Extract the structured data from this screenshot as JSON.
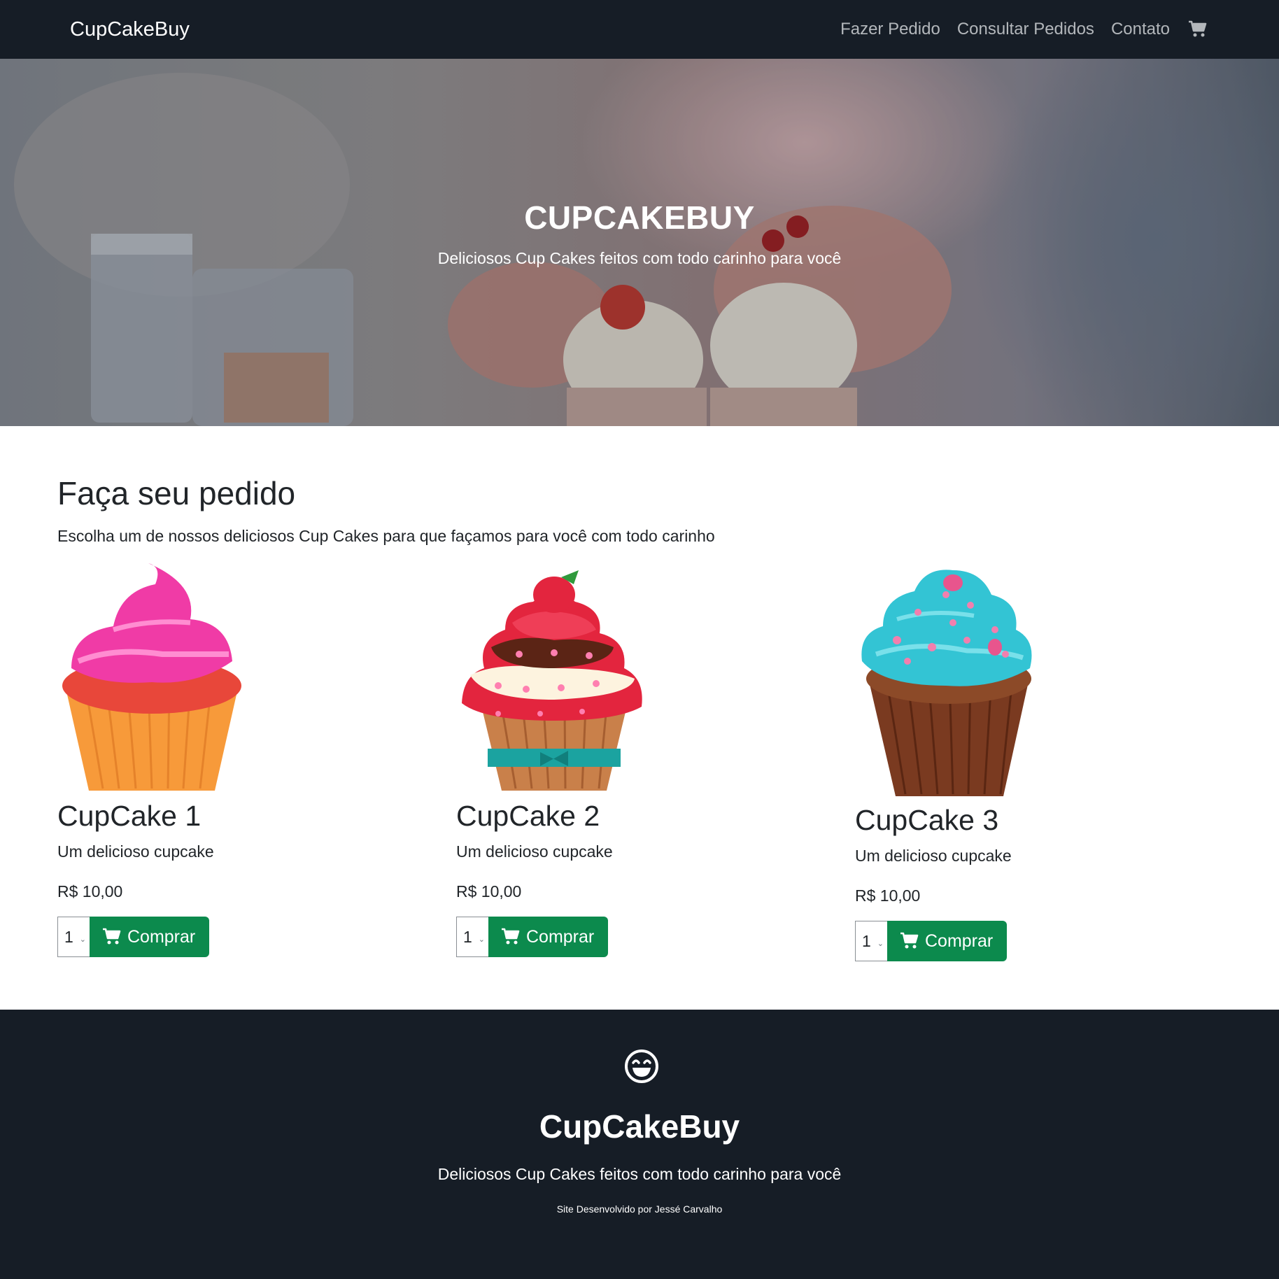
{
  "navbar": {
    "brand": "CupCakeBuy",
    "links": [
      "Fazer Pedido",
      "Consultar Pedidos",
      "Contato"
    ],
    "cart_icon": "cart-icon"
  },
  "hero": {
    "title": "CUPCAKEBUY",
    "subtitle": "Deliciosos Cup Cakes feitos com todo carinho para você"
  },
  "main": {
    "title": "Faça seu pedido",
    "subtitle": "Escolha um de nossos deliciosos Cup Cakes para que façamos para você com todo carinho"
  },
  "products": [
    {
      "name": "CupCake 1",
      "description": "Um delicioso cupcake",
      "price": "R$ 10,00",
      "quantity": "1",
      "button": "Comprar"
    },
    {
      "name": "CupCake 2",
      "description": "Um delicioso cupcake",
      "price": "R$ 10,00",
      "quantity": "1",
      "button": "Comprar"
    },
    {
      "name": "CupCake 3",
      "description": "Um delicioso cupcake",
      "price": "R$ 10,00",
      "quantity": "1",
      "button": "Comprar"
    }
  ],
  "footer": {
    "icon": "laughing-face-icon",
    "title": "CupCakeBuy",
    "subtitle": "Deliciosos Cup Cakes feitos com todo carinho para você",
    "credit": "Site Desenvolvido por Jessé Carvalho"
  },
  "colors": {
    "dark": "#161d26",
    "success": "#0c8a4d",
    "nav_link": "#b3b7bb"
  }
}
